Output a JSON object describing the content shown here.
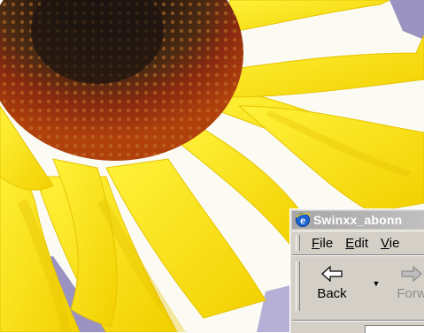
{
  "desktop": {
    "wallpaper": "sunflower-wallpaper",
    "colors": {
      "petal": "#f5e20c",
      "petal_shadow": "#e0b800",
      "disc_center": "#2a1a10",
      "disc_ring": "#8a2a10",
      "background_lavender": "#9a93c2",
      "background_cream": "#fbfbf3"
    }
  },
  "browser_window": {
    "title": "Swinxx_abonn",
    "icon": "ie-icon",
    "menu": [
      {
        "label": "File",
        "mnemonic": "F",
        "rest": "ile"
      },
      {
        "label": "Edit",
        "mnemonic": "E",
        "rest": "dit"
      },
      {
        "label": "Vie",
        "mnemonic": "V",
        "rest": "ie"
      }
    ],
    "toolbar": {
      "back_label": "Back",
      "back_icon": "back-arrow-icon",
      "dropdown_icon": "chevron-down-icon",
      "forward_label": "Forw",
      "forward_icon": "forward-arrow-icon"
    },
    "colors": {
      "chrome": "#d4d0c8",
      "title_bar": "#b0b0b0",
      "disabled_text": "#8c8c8c"
    }
  }
}
